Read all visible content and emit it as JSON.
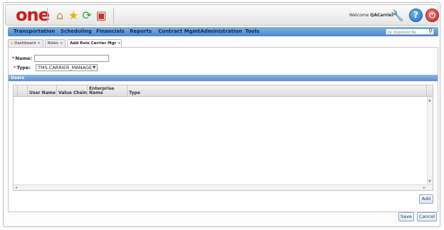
{
  "header": {
    "logo": "one",
    "welcome_prefix": "Welcome",
    "username": "QACarrier"
  },
  "nav": {
    "items": [
      "Transportation",
      "Scheduling",
      "Financials",
      "Reports",
      "Contract Mgmt",
      "Administration",
      "Tools"
    ],
    "search_placeholder": "by Shipment No"
  },
  "tabs": [
    {
      "label": "Dashboard",
      "close": "×"
    },
    {
      "label": "Roles",
      "close": "×"
    },
    {
      "label": "Add Role Carrier Mgr",
      "close": "×"
    }
  ],
  "form": {
    "name_label": "Name:",
    "name_value": "",
    "type_label": "Type:",
    "type_value": "TMS.CARRIER_MANAGER",
    "required_mark": "*"
  },
  "users": {
    "title": "Users",
    "columns": [
      "User Name",
      "Value Chain",
      "Enterprise Name",
      "Type"
    ]
  },
  "buttons": {
    "add": "Add",
    "save": "Save",
    "cancel": "Cancel"
  },
  "colors": {
    "logo_red": "#d21a1a",
    "nav_blue": "#5b93d3",
    "header_blue": "#6b9bd6"
  }
}
